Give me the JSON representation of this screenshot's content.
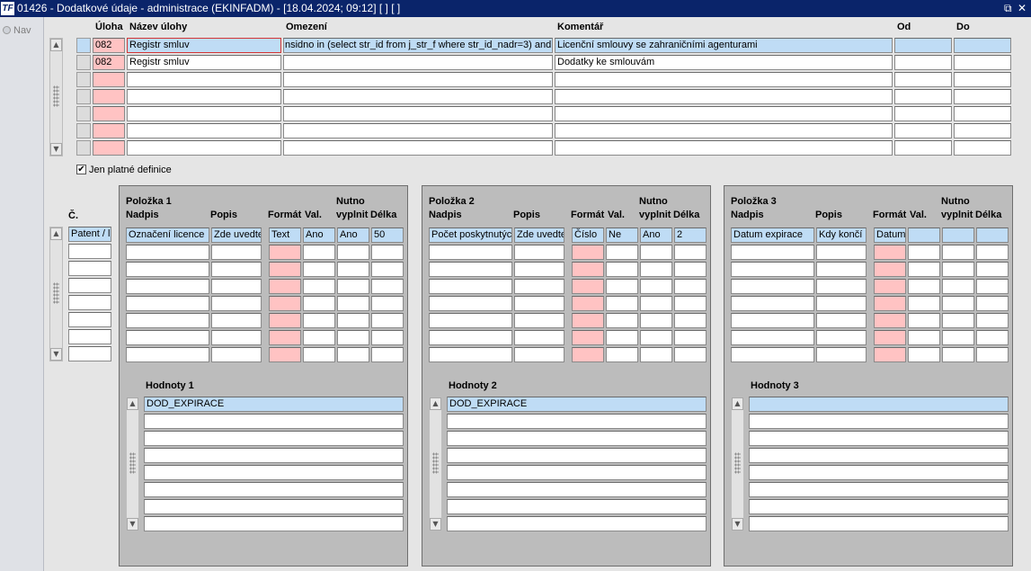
{
  "window": {
    "app_icon": "TF",
    "title": "01426 - Dodatkové údaje - administrace (EKINFADM) - [18.04.2024; 09:12] [ ] [ ]",
    "restore_icon": "⧉",
    "close_icon": "✕"
  },
  "nav": {
    "label": "Nav"
  },
  "upper": {
    "headers": {
      "uloha": "Úloha",
      "nazev": "Název úlohy",
      "omezeni": "Omezení",
      "komentar": "Komentář",
      "od": "Od",
      "do": "Do"
    },
    "rows": [
      {
        "uloha": "082",
        "nazev": "Registr smluv",
        "omezeni": "nsidno in (select str_id from j_str_f where str_id_nadr=3) and",
        "komentar": "Licenční smlouvy se zahraničními agenturami",
        "od": "",
        "do": ""
      },
      {
        "uloha": "082",
        "nazev": "Registr smluv",
        "omezeni": "",
        "komentar": "Dodatky ke smlouvám",
        "od": "",
        "do": ""
      },
      {
        "uloha": "",
        "nazev": "",
        "omezeni": "",
        "komentar": "",
        "od": "",
        "do": ""
      },
      {
        "uloha": "",
        "nazev": "",
        "omezeni": "",
        "komentar": "",
        "od": "",
        "do": ""
      },
      {
        "uloha": "",
        "nazev": "",
        "omezeni": "",
        "komentar": "",
        "od": "",
        "do": ""
      },
      {
        "uloha": "",
        "nazev": "",
        "omezeni": "",
        "komentar": "",
        "od": "",
        "do": ""
      },
      {
        "uloha": "",
        "nazev": "",
        "omezeni": "",
        "komentar": "",
        "od": "",
        "do": ""
      }
    ]
  },
  "filter": {
    "checked": true,
    "check_mark": "✔",
    "label": "Jen platné definice"
  },
  "cislo": {
    "header": "Č.",
    "values": [
      "Patent / lic",
      "",
      "",
      "",
      "",
      "",
      "",
      ""
    ]
  },
  "polozky": [
    {
      "title": "Položka 1",
      "headers": {
        "nadpis": "Nadpis",
        "popis": "Popis",
        "format": "Formát",
        "val": "Val.",
        "nutno1": "Nutno",
        "nutno2": "vyplnit",
        "delka": "Délka"
      },
      "first_row": {
        "nadpis": "Označení licence",
        "popis": "Zde uvedte",
        "format": "Text",
        "val": "Ano",
        "nutno": "Ano",
        "delka": "50"
      },
      "hodnoty_title": "Hodnoty 1",
      "hodnoty": [
        "DOD_EXPIRACE",
        "",
        "",
        "",
        "",
        "",
        "",
        ""
      ]
    },
    {
      "title": "Položka 2",
      "headers": {
        "nadpis": "Nadpis",
        "popis": "Popis",
        "format": "Formát",
        "val": "Val.",
        "nutno1": "Nutno",
        "nutno2": "vyplnit",
        "delka": "Délka"
      },
      "first_row": {
        "nadpis": "Počet poskytnutýc",
        "popis": "Zde uvedte",
        "format": "Číslo",
        "val": "Ne",
        "nutno": "Ano",
        "delka": "2"
      },
      "hodnoty_title": "Hodnoty 2",
      "hodnoty": [
        "DOD_EXPIRACE",
        "",
        "",
        "",
        "",
        "",
        "",
        ""
      ]
    },
    {
      "title": "Položka 3",
      "headers": {
        "nadpis": "Nadpis",
        "popis": "Popis",
        "format": "Formát",
        "val": "Val.",
        "nutno1": "Nutno",
        "nutno2": "vyplnit",
        "delka": "Délka"
      },
      "first_row": {
        "nadpis": "Datum expirace",
        "popis": "Kdy končí p",
        "format": "Datum",
        "val": "",
        "nutno": "",
        "delka": ""
      },
      "hodnoty_title": "Hodnoty 3",
      "hodnoty": [
        "",
        "",
        "",
        "",
        "",
        "",
        "",
        ""
      ]
    }
  ]
}
